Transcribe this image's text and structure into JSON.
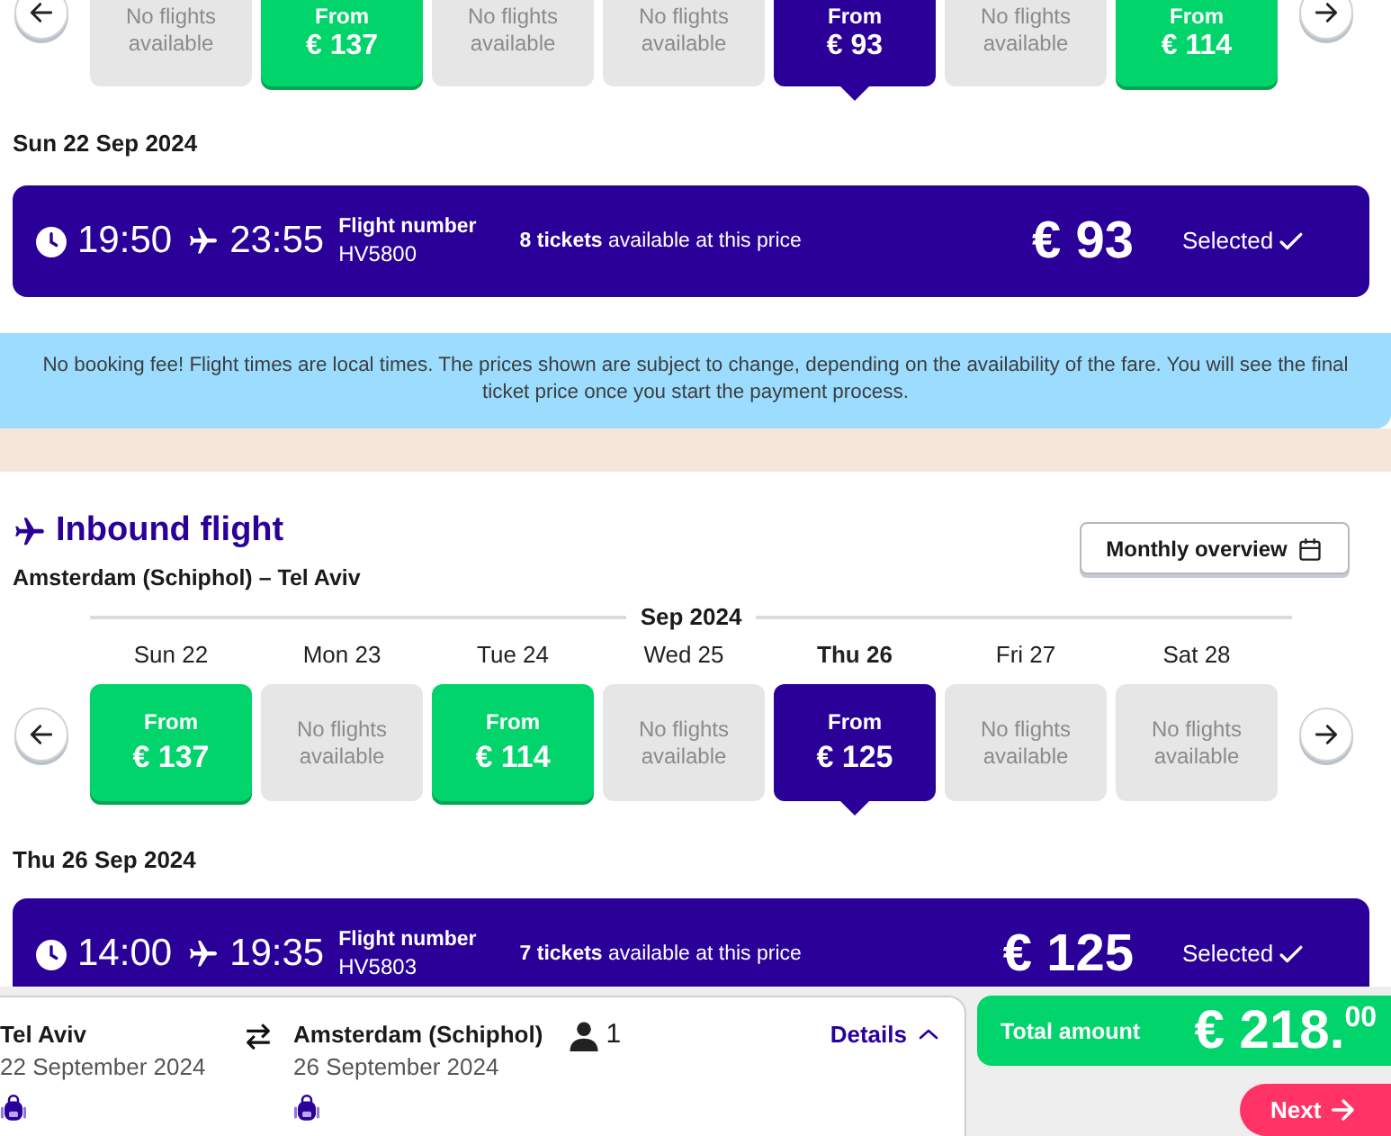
{
  "outbound": {
    "fares": [
      {
        "kind": "none",
        "text": "No flights available",
        "selected": false
      },
      {
        "kind": "fare",
        "label": "From",
        "price": "€ 137",
        "selected": false
      },
      {
        "kind": "none",
        "text": "No flights available",
        "selected": false
      },
      {
        "kind": "none",
        "text": "No flights available",
        "selected": false
      },
      {
        "kind": "fare",
        "label": "From",
        "price": "€ 93",
        "selected": true
      },
      {
        "kind": "none",
        "text": "No flights available",
        "selected": false
      },
      {
        "kind": "fare",
        "label": "From",
        "price": "€ 114",
        "selected": false
      }
    ],
    "date": "Sun 22 Sep 2024",
    "flight": {
      "depart": "19:50",
      "arrive": "23:55",
      "number_label": "Flight number",
      "number": "HV5800",
      "availability": "**8 tickets** available at this price",
      "price": "€ 93",
      "status": "Selected",
      "selected": true
    }
  },
  "notice": "No booking fee! Flight times are local times. The prices shown are subject to change, depending on the availability of the fare. You will see the final ticket price once you start the payment process.",
  "inbound": {
    "title": "Inbound flight",
    "route": "Amsterdam (Schiphol) – Tel Aviv",
    "monthly_button": "Monthly overview",
    "month": "Sep 2024",
    "days": [
      {
        "day": "Sun 22",
        "kind": "fare",
        "label": "From",
        "price": "€ 137",
        "selected": false
      },
      {
        "day": "Mon 23",
        "kind": "none",
        "text": "No flights available",
        "selected": false
      },
      {
        "day": "Tue 24",
        "kind": "fare",
        "label": "From",
        "price": "€ 114",
        "selected": false
      },
      {
        "day": "Wed 25",
        "kind": "none",
        "text": "No flights available",
        "selected": false
      },
      {
        "day": "Thu 26",
        "kind": "fare",
        "label": "From",
        "price": "€ 125",
        "selected": true
      },
      {
        "day": "Fri 27",
        "kind": "none",
        "text": "No flights available",
        "selected": false
      },
      {
        "day": "Sat 28",
        "kind": "none",
        "text": "No flights available",
        "selected": false
      }
    ],
    "date": "Thu 26 Sep 2024",
    "flight": {
      "depart": "14:00",
      "arrive": "19:35",
      "number_label": "Flight number",
      "number": "HV5803",
      "availability": "**7 tickets** available at this price",
      "price": "€ 125",
      "status": "Selected",
      "selected": true
    }
  },
  "summary": {
    "origin": "Tel Aviv",
    "origin_date": "22 September 2024",
    "destination": "Amsterdam (Schiphol)",
    "destination_date": "26 September 2024",
    "passengers": "1",
    "details": "Details",
    "total_label": "Total amount",
    "total": "€ 218.$^{00}$",
    "next": "Next"
  }
}
